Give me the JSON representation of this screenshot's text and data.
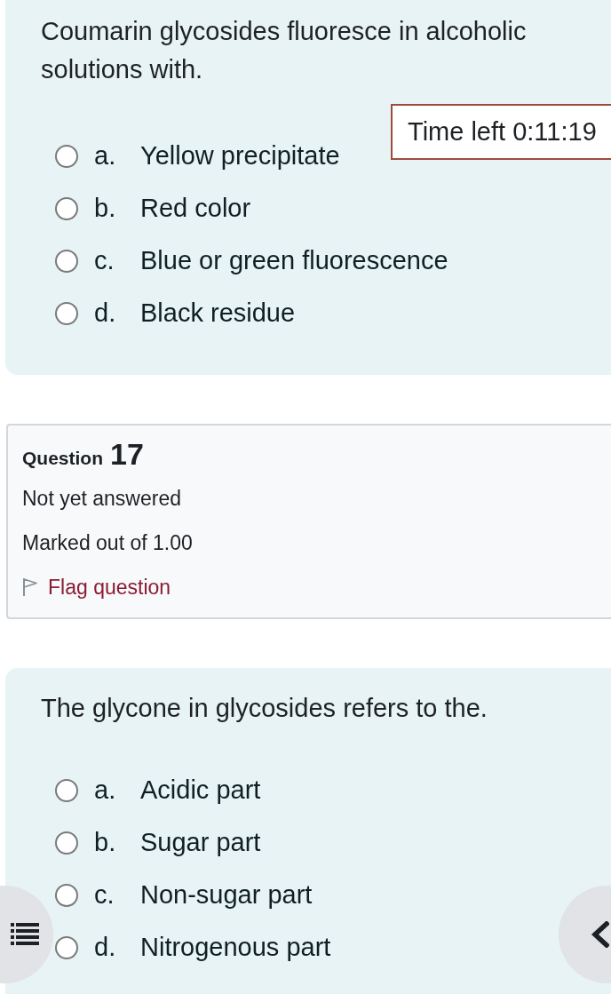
{
  "timer": {
    "text": "Time left 0:11:19"
  },
  "sections": [
    {
      "kind": "question",
      "text": "Coumarin glycosides fluoresce in alcoholic solutions with.",
      "options": [
        {
          "letter": "a.",
          "text": "Yellow precipitate",
          "selected": false
        },
        {
          "letter": "b.",
          "text": "Red color",
          "selected": false
        },
        {
          "letter": "c.",
          "text": "Blue or green fluorescence",
          "selected": false
        },
        {
          "letter": "d.",
          "text": "Black residue",
          "selected": false
        }
      ]
    },
    {
      "kind": "info",
      "title": "Question",
      "number": "17",
      "status": "Not yet answered",
      "marks": "Marked out of 1.00",
      "flag": {
        "label": "Flag question",
        "flagged": false
      }
    },
    {
      "kind": "question",
      "text": "The glycone in glycosides refers to the.",
      "options": [
        {
          "letter": "a.",
          "text": "Acidic part",
          "selected": false
        },
        {
          "letter": "b.",
          "text": "Sugar part",
          "selected": false
        },
        {
          "letter": "c.",
          "text": "Non-sugar part",
          "selected": false
        },
        {
          "letter": "d.",
          "text": "Nitrogenous part",
          "selected": false
        }
      ]
    }
  ]
}
